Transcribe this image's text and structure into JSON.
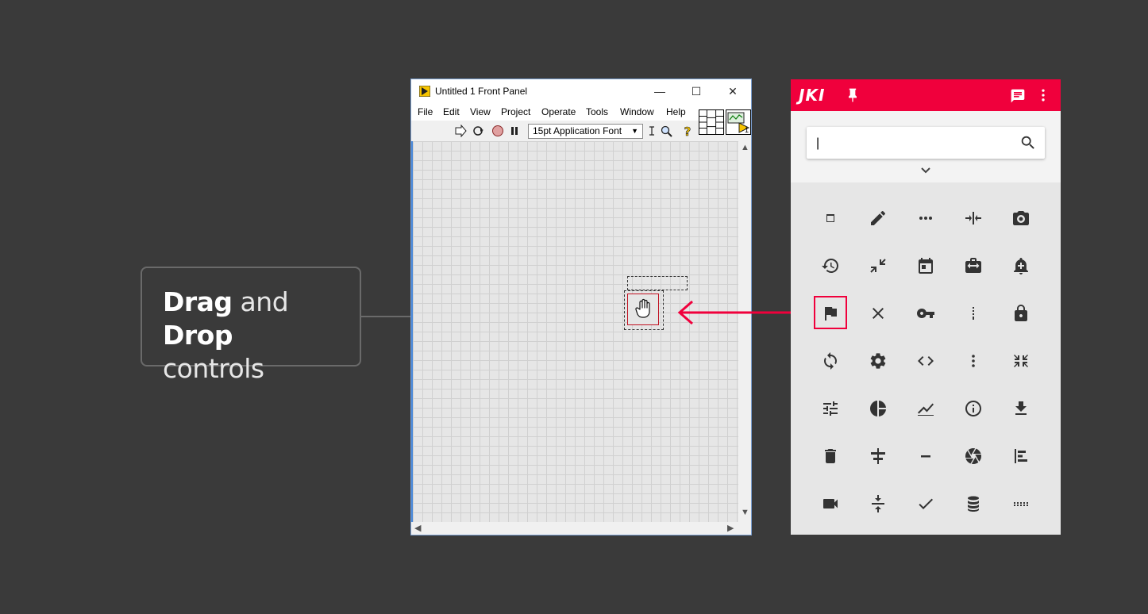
{
  "callout": {
    "bold1": "Drag",
    "plain1": " and ",
    "bold2": "Drop",
    "line2": "controls"
  },
  "labview": {
    "title": "Untitled 1 Front Panel",
    "window_buttons": {
      "minimize": "—",
      "maximize": "☐",
      "close": "✕"
    },
    "menu": [
      "File",
      "Edit",
      "View",
      "Project",
      "Operate",
      "Tools",
      "Window",
      "Help"
    ],
    "font_select": "15pt Application Font",
    "vi_icon_number": "1"
  },
  "jki": {
    "logo": "JKI",
    "search": {
      "value": "",
      "placeholder": ""
    },
    "accent": "#f0003c",
    "icons": [
      "web-asset-icon",
      "edit-icon",
      "more-horiz-icon",
      "vertical-split-icon",
      "camera-icon",
      "restore-icon",
      "compress-icon",
      "calendar-icon",
      "work-transfer-icon",
      "add-alert-icon",
      "flag-icon",
      "close-icon",
      "key-icon",
      "drag-vertical-icon",
      "lock-icon",
      "sync-icon",
      "settings-icon",
      "code-icon",
      "more-vert-icon",
      "compress-arrows-icon",
      "tune-icon",
      "pie-chart-icon",
      "show-chart-icon",
      "info-icon",
      "download-icon",
      "delete-icon",
      "align-center-icon",
      "remove-icon",
      "camera-aperture-icon",
      "align-left-icon",
      "videocam-icon",
      "vertical-align-center-icon",
      "check-icon",
      "storage-icon",
      "dots-grid-icon"
    ],
    "selected_icon": "flag-icon"
  }
}
